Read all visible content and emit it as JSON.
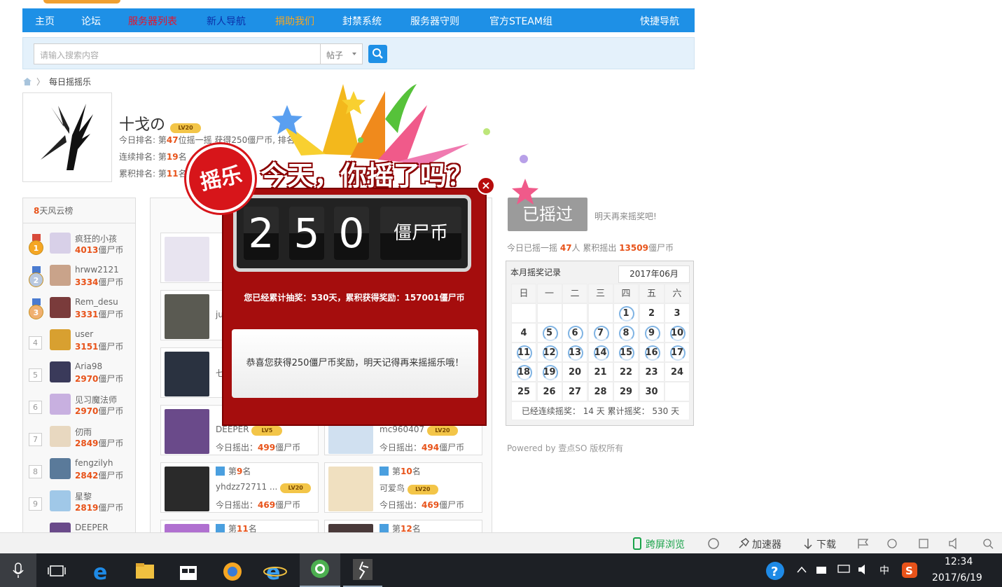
{
  "nav": {
    "items": [
      {
        "label": "主页",
        "color": "#ffffff"
      },
      {
        "label": "论坛",
        "color": "#ffffff"
      },
      {
        "label": "服务器列表",
        "color": "#e8122a"
      },
      {
        "label": "新人导航",
        "color": "#0b2fa8"
      },
      {
        "label": "捐助我们",
        "color": "#f5a623"
      },
      {
        "label": "封禁系统",
        "color": "#ffffff"
      },
      {
        "label": "服务器守则",
        "color": "#ffffff"
      },
      {
        "label": "官方STEAM组",
        "color": "#ffffff"
      }
    ],
    "quick_nav": "快捷导航"
  },
  "search": {
    "placeholder": "请输入搜索内容",
    "type": "帖子"
  },
  "breadcrumb": {
    "current": "每日摇摇乐"
  },
  "user": {
    "name": "十戈の",
    "level": "LV20",
    "today_prefix": "今日排名: 第",
    "today_rank": "47",
    "today_suffix": "位摇一摇 获得250僵尸币, 排名",
    "streak_prefix": "连续排名: 第",
    "streak_rank": "19",
    "streak_suffix": "名",
    "total_prefix": "累积排名: 第",
    "total_rank": "11",
    "total_suffix": "名"
  },
  "sidebar": {
    "title_highlight": "8",
    "title_rest": "天风云榜",
    "unit": "僵尸币",
    "items": [
      {
        "rank": "1",
        "name": "疯狂的小孩",
        "score": "4013",
        "color": "#d8d0e8"
      },
      {
        "rank": "2",
        "name": "hrww2121",
        "score": "3334",
        "color": "#c9a38a"
      },
      {
        "rank": "3",
        "name": "Rem_desu",
        "score": "3331",
        "color": "#7a3b3b"
      },
      {
        "rank": "4",
        "name": "user",
        "score": "3151",
        "color": "#d8a030"
      },
      {
        "rank": "5",
        "name": "Aria98",
        "score": "2970",
        "color": "#3a3a5a"
      },
      {
        "rank": "6",
        "name": "见习魔法师",
        "score": "2970",
        "color": "#c8b0e0"
      },
      {
        "rank": "7",
        "name": "仞雨",
        "score": "2849",
        "color": "#e8d8c0"
      },
      {
        "rank": "8",
        "name": "fengzilyh",
        "score": "2842",
        "color": "#5a7a9a"
      },
      {
        "rank": "9",
        "name": "星黎",
        "score": "2819",
        "color": "#a0c8e8"
      },
      {
        "rank": "",
        "name": "DEEPER",
        "score": "",
        "color": "#6a4a8a"
      }
    ]
  },
  "cards": {
    "rank_prefix": "第",
    "rank_suffix": "名",
    "score_prefix": "今日摇出：",
    "score_suffix": "僵尸币",
    "items": [
      {
        "rank": "",
        "name": "",
        "score": "",
        "level": "",
        "color": "#e8e4f0"
      },
      {
        "rank": "",
        "name": "ju",
        "score": "",
        "level": "",
        "color": "#5a5a52"
      },
      {
        "rank": "",
        "name": "七",
        "score": "",
        "level": "",
        "color": "#2a3240"
      },
      {
        "rank": "",
        "name": "DEEPER",
        "score": "499",
        "level": "LV5",
        "color": "#6a4a8a"
      },
      {
        "rank": "",
        "name": "mc960407",
        "score": "494",
        "level": "LV20",
        "color": "#d0e0f0"
      },
      {
        "rank": "9",
        "name": "yhdzz72711 ...",
        "score": "469",
        "level": "LV20",
        "color": "#2a2a2a"
      },
      {
        "rank": "10",
        "name": "可爱鸟",
        "score": "469",
        "level": "LV20",
        "color": "#f0e0c0"
      },
      {
        "rank": "11",
        "name": "",
        "score": "",
        "level": "",
        "color": "#b070d0"
      },
      {
        "rank": "12",
        "name": "",
        "score": "",
        "level": "",
        "color": "#4a3a3a"
      }
    ]
  },
  "right": {
    "shaken_label": "已摇过",
    "tomorrow_text": "明天再来摇奖吧!",
    "today_prefix": "今日已摇一摇",
    "today_count": "47",
    "today_mid": "人 累积摇出",
    "today_total": "13509",
    "today_unit": "僵尸币"
  },
  "calendar": {
    "title": "本月摇奖记录",
    "month": "2017年06月",
    "weekdays": [
      "日",
      "一",
      "二",
      "三",
      "四",
      "五",
      "六"
    ],
    "leading_blanks": 4,
    "days": 30,
    "shaken_days": [
      1,
      5,
      6,
      7,
      8,
      9,
      10,
      11,
      12,
      13,
      14,
      15,
      16,
      17,
      18,
      19
    ],
    "footer": "已经连续摇奖：  14 天 累计摇奖：  530 天"
  },
  "powered": "Powered by 壹点SO 版权所有",
  "popup": {
    "banner": "今天，你摇了吗？",
    "seal": "摇乐",
    "seal_small": "摇",
    "digits": [
      "2",
      "5",
      "0"
    ],
    "unit": "僵尸币",
    "total_text": "您已经累计抽奖：530天，累积获得奖励：157001僵尸币",
    "message": "恭喜您获得250僵尸币奖励，明天记得再来摇摇乐哦！",
    "close": "×"
  },
  "browser_toolbar": {
    "cross_screen": "跨屏浏览",
    "accelerator": "加速器",
    "download": "下载"
  },
  "taskbar": {
    "ime": "中",
    "time": "12:34",
    "date": "2017/6/19"
  }
}
